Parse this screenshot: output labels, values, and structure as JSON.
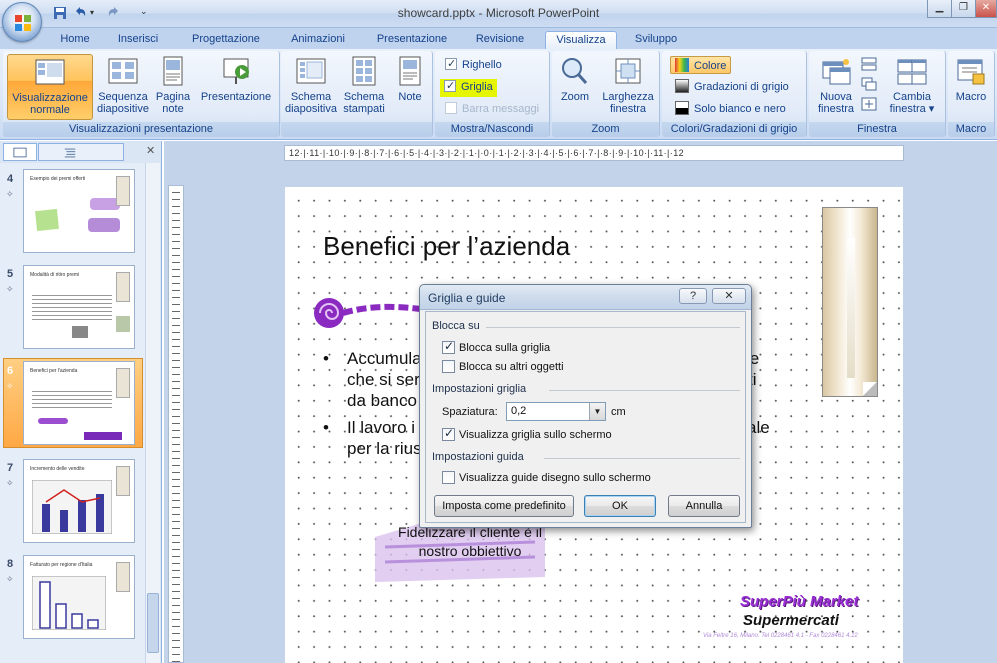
{
  "window": {
    "title": "showcard.pptx - Microsoft PowerPoint",
    "minimize": "▁",
    "restore": "❐",
    "close": "✕"
  },
  "tabs": [
    "Home",
    "Inserisci",
    "Progettazione",
    "Animazioni",
    "Presentazione",
    "Revisione",
    "Visualizza",
    "Sviluppo"
  ],
  "active_tab": "Visualizza",
  "ribbon": {
    "views": {
      "label": "Visualizzazioni presentazione",
      "normal": [
        "Visualizzazione",
        "normale"
      ],
      "sorter": [
        "Sequenza",
        "diapositive"
      ],
      "notes_page": [
        "Pagina",
        "note"
      ],
      "slideshow": [
        "Presentazione",
        ""
      ]
    },
    "masters": {
      "slide_master": [
        "Schema",
        "diapositiva"
      ],
      "handout_master": [
        "Schema",
        "stampati"
      ],
      "notes_master": [
        "Note",
        ""
      ]
    },
    "show": {
      "label": "Mostra/Nascondi",
      "ruler": "Righello",
      "gridlines": "Griglia",
      "message_bar": "Barra messaggi",
      "ruler_checked": true,
      "gridlines_checked": true
    },
    "zoom": {
      "label": "Zoom",
      "zoom": [
        "Zoom",
        ""
      ],
      "fit": [
        "Larghezza",
        "finestra"
      ]
    },
    "color": {
      "label": "Colori/Gradazioni di grigio",
      "color": "Colore",
      "grayscale": "Gradazioni di grigio",
      "bw": "Solo bianco e nero"
    },
    "window": {
      "label": "Finestra",
      "new_window": [
        "Nuova",
        "finestra"
      ],
      "switch": [
        "Cambia",
        "finestra ▾"
      ]
    },
    "macro": {
      "label": "Macro",
      "macro": [
        "Macro",
        ""
      ]
    }
  },
  "thumbnails": [
    {
      "num": "4",
      "title": "Esempio dei premi offerti"
    },
    {
      "num": "5",
      "title": "Modalità di ritiro premi"
    },
    {
      "num": "6",
      "title": "Benefici per l'azienda"
    },
    {
      "num": "7",
      "title": "Incremento delle vendite"
    },
    {
      "num": "8",
      "title": "Fatturato per regione d'Italia"
    }
  ],
  "selected_thumbnail": "6",
  "ruler_labels": "12·|·11·|·10·|·9·|·8·|·7·|·6·|·5·|·4·|·3·|·2·|·1·|·0·|·1·|·2·|·3·|·4·|·5·|·6·|·7·|·8·|·9·|·10·|·11·|·12",
  "slide": {
    "title": "Benefici per l’azienda",
    "bullet1": [
      "Accumula",
      "te",
      "che si ser",
      "ti",
      "da banco"
    ],
    "bullet2": [
      "Il lavoro i",
      "ale",
      "per la rius"
    ],
    "bullet_dot": "•",
    "callout": [
      "Fidelizzare il cliente è il",
      "nostro obbiettivo"
    ],
    "brand1": "SuperPiù Market",
    "brand2": "Supermercati",
    "address": "Via Feltre 16, Milano. Tel 0228461 4.1  - Fax 0228461 4.12"
  },
  "dialog": {
    "title": "Griglia e guide",
    "help": "?",
    "close": "✕",
    "snap_section": "Blocca su",
    "snap_grid": "Blocca sulla griglia",
    "snap_objects": "Blocca su altri oggetti",
    "grid_section": "Impostazioni griglia",
    "spacing_label": "Spaziatura:",
    "spacing_value": "0,2",
    "spacing_unit": "cm",
    "show_grid": "Visualizza griglia sullo schermo",
    "guides_section": "Impostazioni guida",
    "show_guides": "Visualizza guide disegno sullo schermo",
    "set_default": "Imposta come predefinito",
    "ok": "OK",
    "cancel": "Annulla",
    "snap_grid_checked": true,
    "snap_objects_checked": false,
    "show_grid_checked": true,
    "show_guides_checked": false
  },
  "colors": {
    "accent_purple": "#9b2fd6",
    "ribbon_active": "#ffc35b",
    "highlight_yellow": "#e6f500"
  }
}
